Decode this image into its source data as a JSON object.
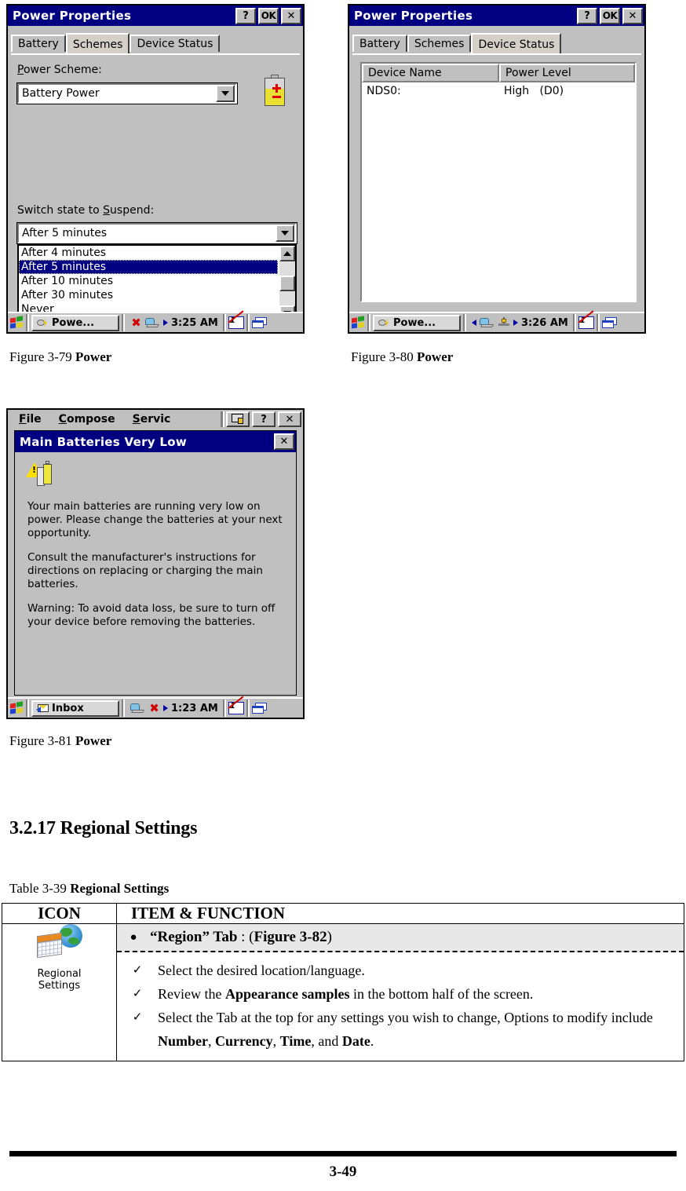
{
  "fig79": {
    "title": "Power Properties",
    "buttons": {
      "help": "?",
      "ok": "OK",
      "close": "✕"
    },
    "tabs": [
      {
        "label": "Battery",
        "active": false
      },
      {
        "label": "Schemes",
        "active": true
      },
      {
        "label": "Device Status",
        "active": false
      }
    ],
    "power_scheme_label": "Power Scheme:",
    "power_scheme_label_accel": "P",
    "power_scheme_value": "Battery Power",
    "switch_label": "Switch state to Suspend:",
    "switch_label_accel": "S",
    "switch_value": "After 5 minutes",
    "dropdown_options": [
      {
        "label": "After 4 minutes",
        "selected": false
      },
      {
        "label": "After 5 minutes",
        "selected": true
      },
      {
        "label": "After 10 minutes",
        "selected": false
      },
      {
        "label": "After 30 minutes",
        "selected": false
      },
      {
        "label": "Never",
        "selected": false
      }
    ],
    "taskbar": {
      "task_label": "Powe...",
      "clock": "3:25 AM"
    },
    "caption_prefix": "Figure 3-79 ",
    "caption_bold": "Power"
  },
  "fig80": {
    "title": "Power Properties",
    "buttons": {
      "help": "?",
      "ok": "OK",
      "close": "✕"
    },
    "tabs": [
      {
        "label": "Battery",
        "active": false
      },
      {
        "label": "Schemes",
        "active": false
      },
      {
        "label": "Device Status",
        "active": true
      }
    ],
    "columns": [
      "Device Name",
      "Power Level"
    ],
    "rows": [
      {
        "device": "NDS0:",
        "level": "High   (D0)"
      }
    ],
    "taskbar": {
      "task_label": "Powe...",
      "clock": "3:26 AM"
    },
    "caption_prefix": "Figure 3-80 ",
    "caption_bold": "Power"
  },
  "fig81": {
    "menus": [
      {
        "label": "File",
        "accel": "F"
      },
      {
        "label": "Compose",
        "accel": "C"
      },
      {
        "label": "Servic",
        "accel": "S"
      }
    ],
    "menubar_buttons": {
      "keyboard": "",
      "help": "?",
      "close": "✕"
    },
    "dialog_title": "Main Batteries Very Low",
    "dialog_close": "✕",
    "paragraphs": [
      "Your main batteries are running very low on power. Please change the batteries at your next opportunity.",
      "Consult the manufacturer's instructions for directions on replacing or charging the main batteries.",
      "Warning: To avoid data loss, be sure to turn off your device before removing the batteries."
    ],
    "taskbar": {
      "task_label": "Inbox",
      "clock": "1:23 AM"
    },
    "caption_prefix": "Figure 3-81 ",
    "caption_bold": "Power"
  },
  "section": {
    "number": "3.2.17",
    "title": "Regional Settings",
    "heading": "3.2.17 Regional Settings"
  },
  "table": {
    "caption_prefix": "Table 3-39 ",
    "caption_bold": "Regional Settings",
    "headers": [
      "ICON",
      "ITEM & FUNCTION"
    ],
    "icon": {
      "label_line1": "Regional",
      "label_line2": "Settings"
    },
    "bullet": {
      "marker": "●",
      "text_open": "“Region” Tab",
      "text_sep": " : (",
      "text_ref": "Figure 3-82",
      "text_close": ")"
    },
    "items": [
      {
        "check": "✓",
        "html": "Select the desired location/language."
      },
      {
        "check": "✓",
        "html": "Review the <b>Appearance samples</b> in the bottom half of the screen."
      },
      {
        "check": "✓",
        "html": "Select the Tab at the top for any settings you wish to change, Options to modify include <b>Number</b>, <b>Currency</b>, <b>Time</b>, and <b>Date</b>."
      }
    ]
  },
  "footer": {
    "page": "3-49"
  },
  "colors": {
    "titlebar": "#000080",
    "face": "#c0c0c0",
    "highlight": "#000080",
    "bullet_row_bg": "#e8e8e8"
  }
}
